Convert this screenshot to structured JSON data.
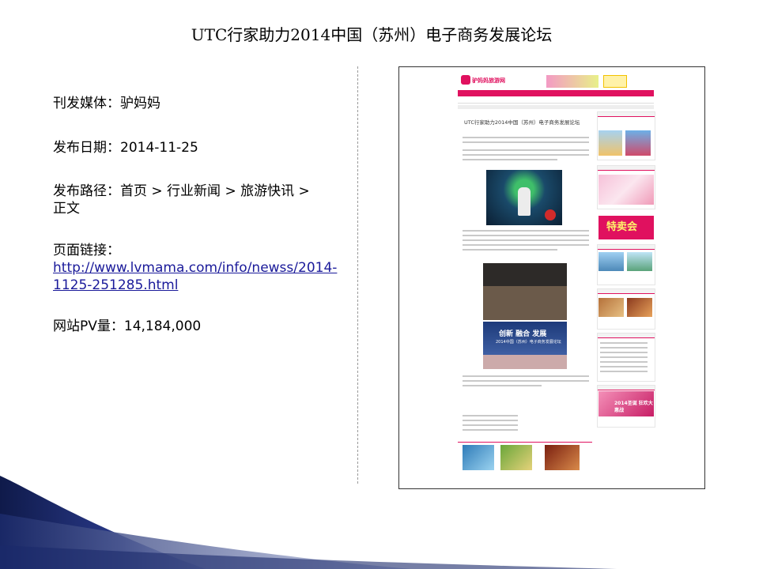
{
  "title": "UTC行家助力2014中国（苏州）电子商务发展论坛",
  "info": {
    "media_label": "刊发媒体：",
    "media_value": "驴妈妈",
    "date_label": "发布日期：",
    "date_value": "2014-11-25",
    "path_label": "发布路径：",
    "path_value_line1": "首页 > 行业新闻 > 旅游快讯 >",
    "path_value_line2": "正文",
    "link_label": "页面链接：",
    "link_line1": "http://www.lvmama.com/info/newss/2014-",
    "link_line2": "1125-251285.html",
    "pv_label": "网站PV量：",
    "pv_value": "14,184,000"
  },
  "screenshot": {
    "site_name": "驴妈妈旅游网",
    "article_title": "UTC行家助力2014中国（苏州）电子商务发展论坛",
    "image_caption_1": "创新 融合 发展",
    "image_caption_2": "2014中国（苏州）电子商务发展论坛",
    "promo_sale": "特卖会",
    "promo_banner": "2014圣诞 狂欢大惠战"
  },
  "colors": {
    "brand_pink": "#e0115f",
    "deco_navy": "#1b2a6b",
    "link_blue": "#1a1a9a"
  }
}
